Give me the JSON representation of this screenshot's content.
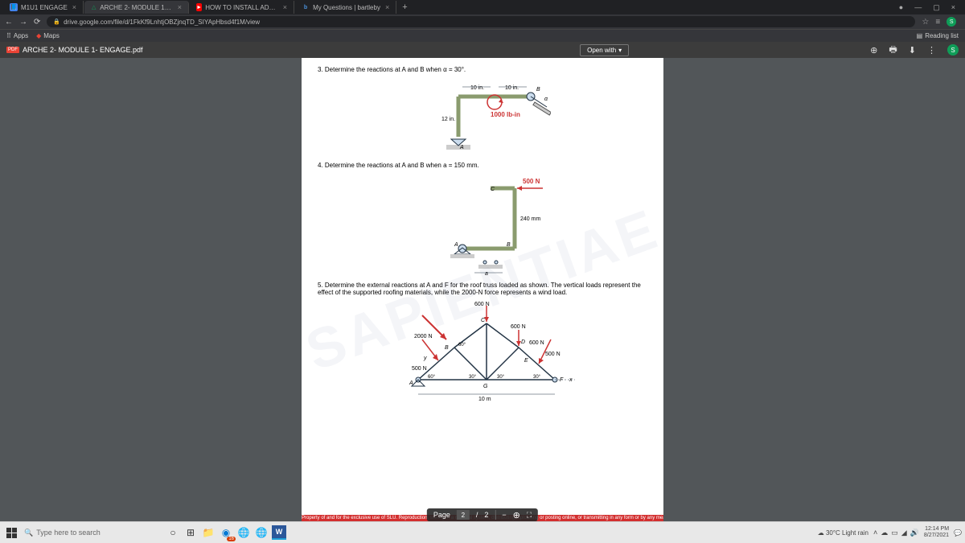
{
  "tabs": [
    {
      "icon_bg": "#4285f4",
      "icon": "📘",
      "label": "M1U1 ENGAGE"
    },
    {
      "icon_bg": "#0f9d58",
      "icon": "△",
      "label": "ARCHE 2- MODULE 1- ENGAGE.p"
    },
    {
      "icon_bg": "#ff0000",
      "icon": "►",
      "label": "HOW TO INSTALL ADOBE PHOTO"
    },
    {
      "icon_bg": "#4a90d9",
      "icon": "b",
      "label": "My Questions | bartleby"
    }
  ],
  "url": "drive.google.com/file/d/1FkKf9LnhtjOBZjnqTD_SIYApHbsd4f1M/view",
  "bookmarks": {
    "apps": "Apps",
    "maps": "Maps",
    "reading_list": "Reading list"
  },
  "pdf": {
    "badge": "PDF",
    "filename": "ARCHE 2- MODULE 1- ENGAGE.pdf",
    "open_with": "Open with",
    "profile": "S"
  },
  "problems": {
    "p3": "3.  Determine the reactions at A and B when α = 30°.",
    "p3_fig": {
      "d1": "10 in.",
      "d2": "10 in.",
      "h": "12 in.",
      "moment": "1000 lb-in",
      "A": "A",
      "B": "B",
      "alpha": "α"
    },
    "p4": "4.  Determine the reactions at A and B when a = 150 mm.",
    "p4_fig": {
      "force": "500 N",
      "h": "240 mm",
      "A": "A",
      "B": "B",
      "C": "C",
      "a": "a"
    },
    "p5": "5.  Determine the external reactions at A and F for the roof truss loaded as shown. The vertical loads represent the effect of the supported roofing materials, while the 2000-N force represents a wind load.",
    "p5_fig": {
      "f600a": "600 N",
      "f600b": "600 N",
      "f600c": "600 N",
      "f500a": "500 N",
      "f500b": "500 N",
      "f2000": "2000 N",
      "a60a": "60°",
      "a60b": "60°",
      "a30a": "30°",
      "a30b": "30°",
      "a30c": "30°",
      "span": "10 m",
      "A": "A",
      "B": "B",
      "C": "C",
      "D": "D",
      "E": "E",
      "F": "F",
      "G": "G",
      "x": "x",
      "y": "y"
    }
  },
  "copyright": "Property of and for the exclusive use of SLU. Reproduction, storing in a retrieval system, distributing, uploading or posting online, or transmitting in any form or by any means,",
  "page_controls": {
    "label": "Page",
    "current": "2",
    "total": "2"
  },
  "taskbar": {
    "search_placeholder": "Type here to search",
    "weather": "30°C  Light rain",
    "time": "12:14 PM",
    "date": "8/27/2021",
    "edge_badge": "16"
  }
}
